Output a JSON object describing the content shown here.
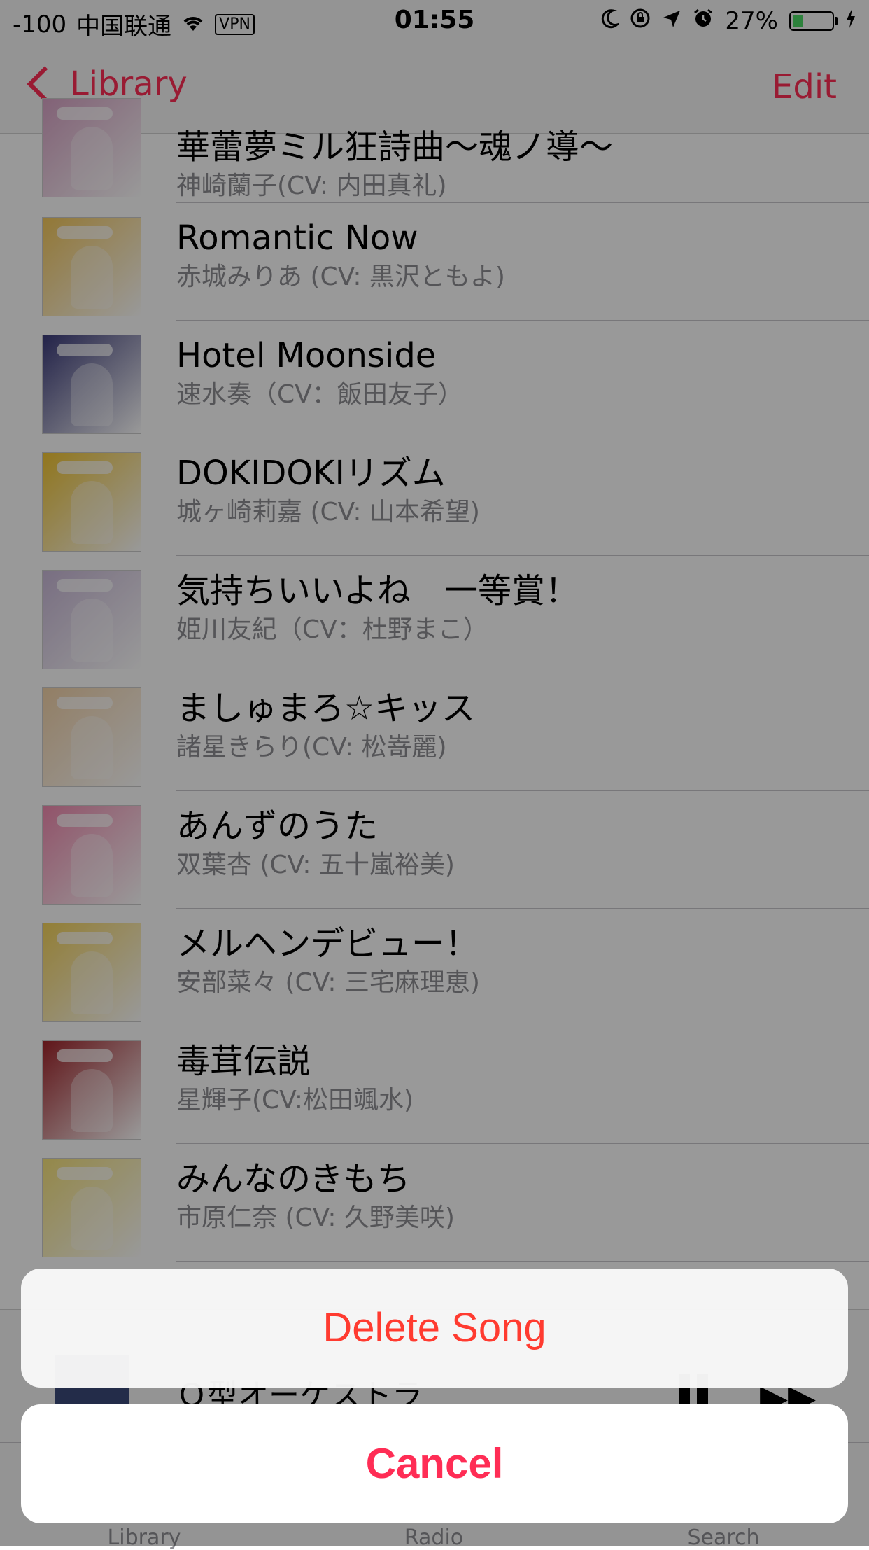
{
  "status_bar": {
    "signal": "-100",
    "carrier": "中国联通",
    "vpn": "VPN",
    "time": "01:55",
    "battery_text": "27%",
    "battery_level": 0.27,
    "battery_color": "#4cd964"
  },
  "nav": {
    "back_label": "Library",
    "edit_label": "Edit",
    "accent_color": "#ff2d55"
  },
  "songs": [
    {
      "title": "華蕾夢ミル狂詩曲～魂ノ導～",
      "artist": "神崎蘭子(CV: 内田真礼)",
      "art_color": "#d9a3c6"
    },
    {
      "title": "Romantic Now",
      "artist": "赤城みりあ (CV: 黒沢ともよ)",
      "art_color": "#f5c85a"
    },
    {
      "title": "Hotel Moonside",
      "artist": "速水奏（CV：飯田友子）",
      "art_color": "#3a3a7a"
    },
    {
      "title": "DOKIDOKIリズム",
      "artist": "城ヶ崎莉嘉 (CV: 山本希望)",
      "art_color": "#f2c530"
    },
    {
      "title": "気持ちいいよね　一等賞！",
      "artist": "姫川友紀（CV：杜野まこ）",
      "art_color": "#c9b8d8"
    },
    {
      "title": "ましゅまろ☆キッス",
      "artist": "諸星きらり(CV: 松嵜麗)",
      "art_color": "#f4d3a8"
    },
    {
      "title": "あんずのうた",
      "artist": "双葉杏 (CV: 五十嵐裕美)",
      "art_color": "#f28ab0"
    },
    {
      "title": "メルヘンデビュー！",
      "artist": "安部菜々 (CV: 三宅麻理恵)",
      "art_color": "#f5d35a"
    },
    {
      "title": "毒茸伝説",
      "artist": "星輝子(CV:松田颯水)",
      "art_color": "#a0242a"
    },
    {
      "title": "みんなのきもち",
      "artist": "市原仁奈 (CV: 久野美咲)",
      "art_color": "#f7e37a"
    }
  ],
  "mini_player": {
    "title": "Ｏ型オーケストラ"
  },
  "tabs": [
    "Library",
    "Radio",
    "Search"
  ],
  "action_sheet": {
    "delete_label": "Delete Song",
    "cancel_label": "Cancel",
    "destructive_color": "#ff3b30"
  }
}
